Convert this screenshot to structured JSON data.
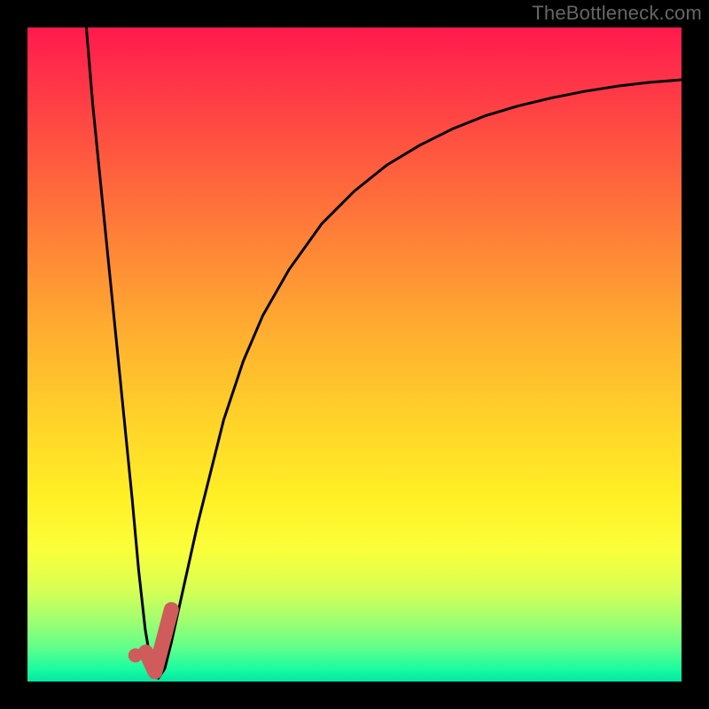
{
  "watermark": "TheBottleneck.com",
  "chart_data": {
    "type": "line",
    "title": "",
    "xlabel": "",
    "ylabel": "",
    "xlim": [
      0,
      100
    ],
    "ylim": [
      0,
      100
    ],
    "series": [
      {
        "name": "curve",
        "x": [
          9,
          10,
          12,
          14,
          16,
          17,
          18,
          19,
          20,
          21,
          22,
          24,
          26,
          28,
          30,
          33,
          36,
          40,
          45,
          50,
          55,
          60,
          65,
          70,
          75,
          80,
          85,
          90,
          95,
          100
        ],
        "values": [
          100,
          88,
          68,
          48,
          28,
          17,
          8,
          2,
          0.5,
          2,
          6,
          15,
          24,
          32,
          40,
          49,
          56,
          63,
          70,
          75,
          79,
          82,
          84.5,
          86.5,
          88,
          89.2,
          90.2,
          91,
          91.6,
          92
        ]
      }
    ],
    "shapes": {
      "dot": {
        "x": 16.5,
        "y": 4.0
      },
      "check_path": [
        {
          "x": 18.1,
          "y": 4.5
        },
        {
          "x": 19.5,
          "y": 1.5
        },
        {
          "x": 22.0,
          "y": 11.0
        }
      ]
    },
    "colors": {
      "curve": "#000000",
      "shape": "#cf5b5b",
      "frame": "#000000"
    }
  }
}
